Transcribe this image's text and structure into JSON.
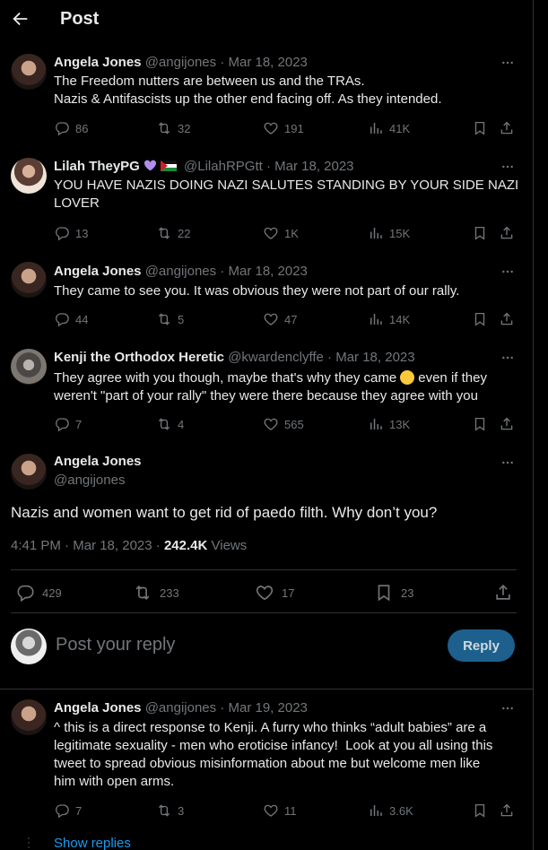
{
  "header": {
    "title": "Post",
    "back_icon": "arrow-left-icon"
  },
  "replies_top": [
    {
      "name": "Angela Jones",
      "handle": "@angijones",
      "sep": "·",
      "date": "Mar 18, 2023",
      "text": "The Freedom nutters are between us and the TRAs.\nNazis & Antifascists up the other end facing off. As they intended.",
      "stats": {
        "replies": "86",
        "reposts": "32",
        "likes": "191",
        "views": "41K"
      }
    },
    {
      "name": "Lilah TheyPG",
      "handle": "@LilahRPGtt",
      "sep": "·",
      "date": "Mar 18, 2023",
      "text": "YOU HAVE NAZIS DOING NAZI SALUTES STANDING BY YOUR SIDE NAZI\nLOVER",
      "stats": {
        "replies": "13",
        "reposts": "22",
        "likes": "1K",
        "views": "15K"
      }
    },
    {
      "name": "Angela Jones",
      "handle": "@angijones",
      "sep": "·",
      "date": "Mar 18, 2023",
      "text": "They came to see you. It was obvious they were not part of our rally.",
      "stats": {
        "replies": "44",
        "reposts": "5",
        "likes": "47",
        "views": "14K"
      }
    },
    {
      "name": "Kenji the Orthodox Heretic",
      "handle": "@kwardenclyffe",
      "sep": "·",
      "date": "Mar 18, 2023",
      "text_a": "They agree with you though, maybe that's why they came",
      "text_b": "even if they",
      "text_c": "weren't \"part of your rally\" they were there because they agree with you",
      "stats": {
        "replies": "7",
        "reposts": "4",
        "likes": "565",
        "views": "13K"
      }
    }
  ],
  "main_post": {
    "name": "Angela Jones",
    "handle": "@angijones",
    "text": "Nazis and women want to get rid of paedo filth. Why don’t you?",
    "time": "4:41 PM",
    "sep": "·",
    "date": "Mar 18, 2023",
    "sep2": "·",
    "views_count": "242.4K",
    "views_label": "Views",
    "stats": {
      "replies": "429",
      "reposts": "233",
      "likes": "17",
      "bookmarks": "23"
    }
  },
  "composer": {
    "placeholder": "Post your reply",
    "button": "Reply"
  },
  "reply_bottom": {
    "name": "Angela Jones",
    "handle": "@angijones",
    "sep": "·",
    "date": "Mar 19, 2023",
    "text": "^ this is a direct response to Kenji. A furry who thinks “adult babies” are a\nlegitimate sexuality - men who eroticise infancy!  Look at you all using this\ntweet to spread obvious misinformation about me but welcome men like\nhim with open arms.",
    "stats": {
      "replies": "7",
      "reposts": "3",
      "likes": "11",
      "views": "3.6K"
    }
  },
  "show_replies": "Show replies"
}
